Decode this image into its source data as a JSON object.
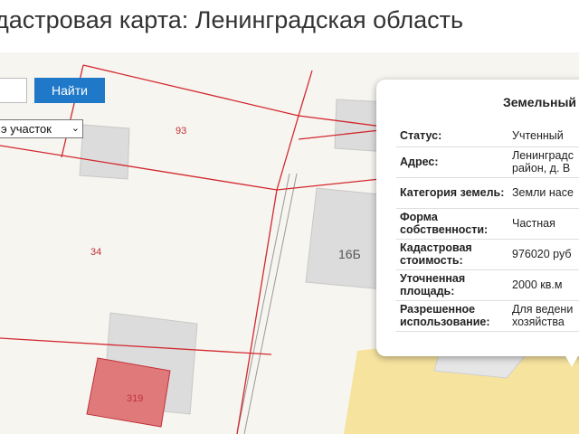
{
  "page": {
    "title": "дастровая карта: Ленинградская область"
  },
  "search": {
    "button_label": "Найти",
    "value": ""
  },
  "filter": {
    "selected": "э участок"
  },
  "map": {
    "parcel_labels": [
      "93",
      "34",
      "319",
      "16Б"
    ],
    "highlight_color": "#e07a7a",
    "line_color": "#d2282e"
  },
  "popup": {
    "title": "Земельный",
    "rows": [
      {
        "key": "Статус:",
        "value": "Учтенный"
      },
      {
        "key": "Адрес:",
        "value": "Ленинградс район, д. В"
      },
      {
        "key": "Категория земель:",
        "value": "Земли насе"
      },
      {
        "key": "Форма собственности:",
        "value": "Частная"
      },
      {
        "key": "Кадастровая стоимость:",
        "value": "976020 руб"
      },
      {
        "key": "Уточненная площадь:",
        "value": "2000 кв.м"
      },
      {
        "key": "Разрешенное использование:",
        "value": "Для ведени хозяйства"
      }
    ]
  }
}
